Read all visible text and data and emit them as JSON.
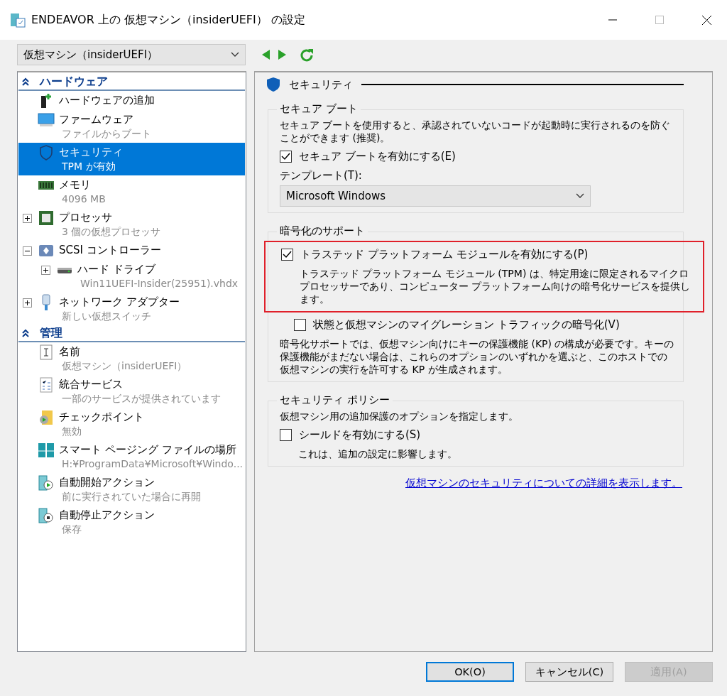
{
  "window": {
    "title": "ENDEAVOR 上の 仮想マシン（insiderUEFI） の設定"
  },
  "vm_selector": {
    "value": "仮想マシン（insiderUEFI）"
  },
  "sidebar": {
    "sections": [
      {
        "label": "ハードウェア",
        "expanded": true,
        "items": [
          {
            "kind": "leaf",
            "label": "ハードウェアの追加",
            "selected": false
          },
          {
            "kind": "leaf",
            "label": "ファームウェア",
            "detail": "ファイルからブート",
            "selected": false
          },
          {
            "kind": "leaf",
            "label": "セキュリティ",
            "detail": "TPM が有効",
            "selected": true
          },
          {
            "kind": "leaf",
            "label": "メモリ",
            "detail": "4096 MB",
            "selected": false
          },
          {
            "kind": "node",
            "label": "プロセッサ",
            "detail": "3 個の仮想プロセッサ",
            "selected": false,
            "expanded": false
          },
          {
            "kind": "node",
            "label": "SCSI コントローラー",
            "selected": false,
            "expanded": true,
            "children": [
              {
                "kind": "node",
                "label": "ハード ドライブ",
                "detail": "Win11UEFI-Insider(25951).vhdx",
                "selected": false,
                "expanded": false
              }
            ]
          },
          {
            "kind": "node",
            "label": "ネットワーク アダプター",
            "detail": "新しい仮想スイッチ",
            "selected": false,
            "expanded": false
          }
        ]
      },
      {
        "label": "管理",
        "expanded": true,
        "items": [
          {
            "kind": "leaf",
            "label": "名前",
            "detail": "仮想マシン（insiderUEFI）",
            "selected": false
          },
          {
            "kind": "leaf",
            "label": "統合サービス",
            "detail": "一部のサービスが提供されています",
            "selected": false
          },
          {
            "kind": "leaf",
            "label": "チェックポイント",
            "detail": "無効",
            "selected": false
          },
          {
            "kind": "leaf",
            "label": "スマート ページング ファイルの場所",
            "detail": "H:¥ProgramData¥Microsoft¥Windo...",
            "selected": false
          },
          {
            "kind": "leaf",
            "label": "自動開始アクション",
            "detail": "前に実行されていた場合に再開",
            "selected": false
          },
          {
            "kind": "leaf",
            "label": "自動停止アクション",
            "detail": "保存",
            "selected": false
          }
        ]
      }
    ]
  },
  "panel": {
    "heading": "セキュリティ",
    "groups": [
      {
        "title": "セキュア ブート",
        "items": [
          {
            "kind": "text",
            "text": "セキュア ブートを使用すると、承認されていないコードが起動時に実行されるのを防ぐことができます (推奨)。"
          },
          {
            "kind": "checkbox",
            "label": "セキュア ブートを有効にする(E)",
            "checked": true
          },
          {
            "kind": "select",
            "label": "テンプレート(T):",
            "value": "Microsoft Windows"
          }
        ]
      },
      {
        "title": "暗号化のサポート",
        "items": [
          {
            "kind": "checkbox",
            "label": "トラステッド プラットフォーム モジュールを有効にする(P)",
            "checked": true,
            "highlighted": true,
            "note": "トラステッド プラットフォーム モジュール (TPM) は、特定用途に限定されるマイクロプロセッサーであり、コンピューター プラットフォーム向けの暗号化サービスを提供します。"
          },
          {
            "kind": "subcheckbox",
            "label": "状態と仮想マシンのマイグレーション トラフィックの暗号化(V)",
            "checked": false
          },
          {
            "kind": "text",
            "text": "暗号化サポートでは、仮想マシン向けにキーの保護機能 (KP) の構成が必要です。キーの保護機能がまだない場合は、これらのオプションのいずれかを選ぶと、このホストでの仮想マシンの実行を許可する KP が生成されます。"
          }
        ]
      },
      {
        "title": "セキュリティ ポリシー",
        "items": [
          {
            "kind": "text",
            "text": "仮想マシン用の追加保護のオプションを指定します。"
          },
          {
            "kind": "checkbox",
            "label": "シールドを有効にする(S)",
            "checked": false,
            "note": "これは、追加の設定に影響します。"
          }
        ]
      }
    ],
    "link": "仮想マシンのセキュリティについての詳細を表示します。"
  },
  "buttons": [
    {
      "label": "OK(O)",
      "default": true,
      "disabled": false
    },
    {
      "label": "キャンセル(C)",
      "default": false,
      "disabled": false
    },
    {
      "label": "適用(A)",
      "default": false,
      "disabled": true
    }
  ]
}
